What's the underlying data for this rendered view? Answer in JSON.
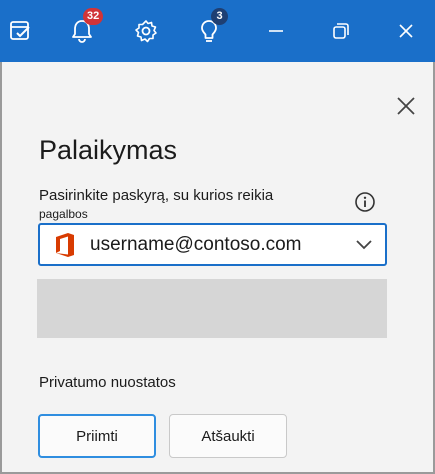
{
  "titlebar": {
    "notifications_count": "32",
    "tips_count": "3",
    "background_color": "#1a6fc9"
  },
  "panel": {
    "title": "Palaikymas",
    "account_label_line1": "Pasirinkite paskyrą, su kurios reikia",
    "account_label_line2": "pagalbos",
    "selected_account": "username@contoso.com",
    "privacy_link": "Privatumo nuostatos",
    "accept_label": "Priimti",
    "cancel_label": "Atšaukti"
  },
  "icons": {
    "tasks": "tasks-icon",
    "bell": "bell-icon",
    "settings": "gear-icon",
    "tips": "lightbulb-icon",
    "minimize": "minimize-icon",
    "restore": "restore-icon",
    "close": "close-icon",
    "panel_close": "close-icon",
    "info": "info-icon",
    "office": "office-logo-icon",
    "dropdown": "chevron-down-icon"
  }
}
